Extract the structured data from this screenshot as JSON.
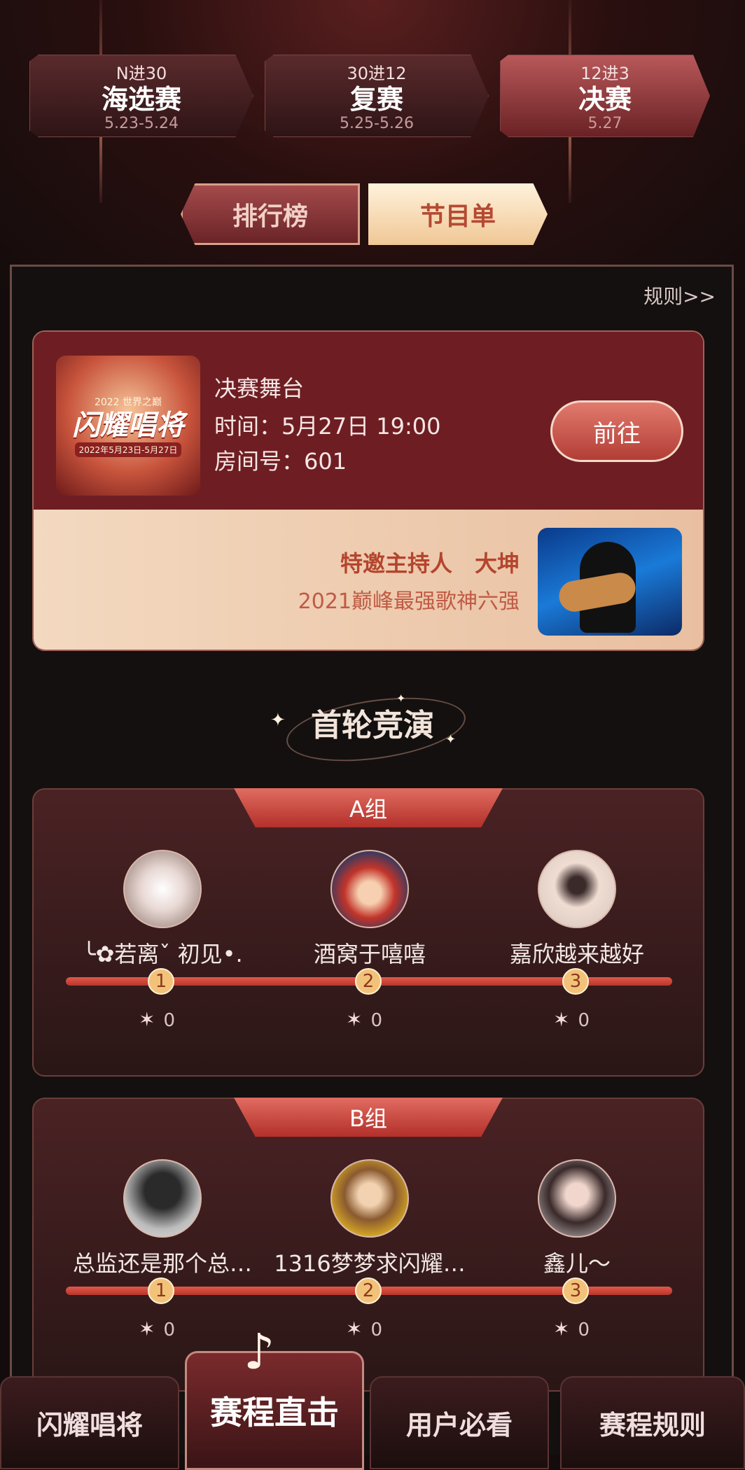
{
  "stages": [
    {
      "top": "N进30",
      "name": "海选赛",
      "date": "5.23-5.24"
    },
    {
      "top": "30进12",
      "name": "复赛",
      "date": "5.25-5.26"
    },
    {
      "top": "12进3",
      "name": "决赛",
      "date": "5.27"
    }
  ],
  "tabs": {
    "rank": "排行榜",
    "program": "节目单"
  },
  "rules_link": "规则>>",
  "final": {
    "poster_line1": "2022 世界之巅",
    "poster_line2": "闪耀唱将",
    "poster_line3": "2022年5月23日-5月27日",
    "title": "决赛舞台",
    "time": "时间：5月27日 19:00",
    "room": "房间号：601",
    "go_label": "前往",
    "host_title": "特邀主持人　大坤",
    "host_desc": "2021巅峰最强歌神六强"
  },
  "section_title": "首轮竞演",
  "groups": [
    {
      "name": "A组",
      "players": [
        {
          "name": "╰✿若离ˇ 初见•.",
          "rank": "1",
          "score": "0"
        },
        {
          "name": "酒窝于嘻嘻",
          "rank": "2",
          "score": "0"
        },
        {
          "name": "嘉欣越来越好",
          "rank": "3",
          "score": "0"
        }
      ]
    },
    {
      "name": "B组",
      "players": [
        {
          "name": "总监还是那个总…",
          "rank": "1",
          "score": "0"
        },
        {
          "name": "1316梦梦求闪耀…",
          "rank": "2",
          "score": "0"
        },
        {
          "name": "鑫儿～",
          "rank": "3",
          "score": "0"
        }
      ]
    }
  ],
  "nav": {
    "item1": "闪耀唱将",
    "item2": "赛程直击",
    "item3": "用户必看",
    "item4": "赛程规则"
  },
  "colors": {
    "accent": "#b23e36",
    "gold": "#f3c27a",
    "card": "#6e1e22"
  }
}
